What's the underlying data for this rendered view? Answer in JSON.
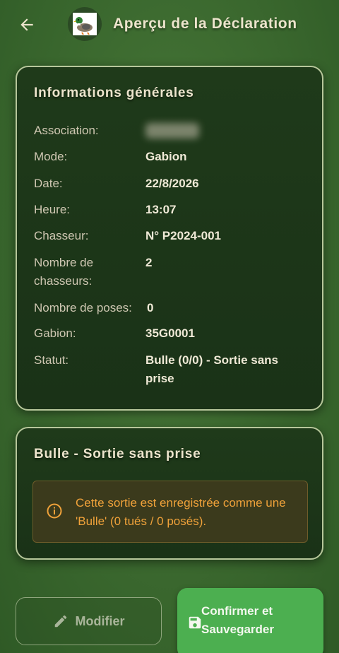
{
  "appbar": {
    "title": "Aperçu de la Déclaration",
    "back_icon": "arrow-left-icon",
    "logo_icon": "duck-logo-icon"
  },
  "info_card": {
    "title": "Informations générales",
    "rows": [
      {
        "label": "Association:",
        "value": ""
      },
      {
        "label": "Mode:",
        "value": "Gabion"
      },
      {
        "label": "Date:",
        "value": "22/8/2026"
      },
      {
        "label": "Heure:",
        "value": "13:07"
      },
      {
        "label": "Chasseur:",
        "value": "N° P2024-001"
      },
      {
        "label": "Nombre de chasseurs:",
        "value": "2"
      },
      {
        "label": "Nombre de poses:",
        "value": "0"
      },
      {
        "label": "Gabion:",
        "value": "35G0001"
      },
      {
        "label": "Statut:",
        "value": "Bulle (0/0) - Sortie sans prise"
      }
    ]
  },
  "bulle_card": {
    "title": "Bulle - Sortie sans prise",
    "alert_text": "Cette sortie est enregistrée comme une 'Bulle' (0 tués / 0 posés).",
    "alert_icon": "info-icon"
  },
  "actions": {
    "modify_label": "Modifier",
    "modify_icon": "pencil-icon",
    "confirm_label": "Confirmer et Sauvegarder",
    "confirm_icon": "save-icon"
  },
  "colors": {
    "accent_green": "#4caf50",
    "warning_orange": "#f0a23a",
    "card_border": "#b7c79b"
  }
}
